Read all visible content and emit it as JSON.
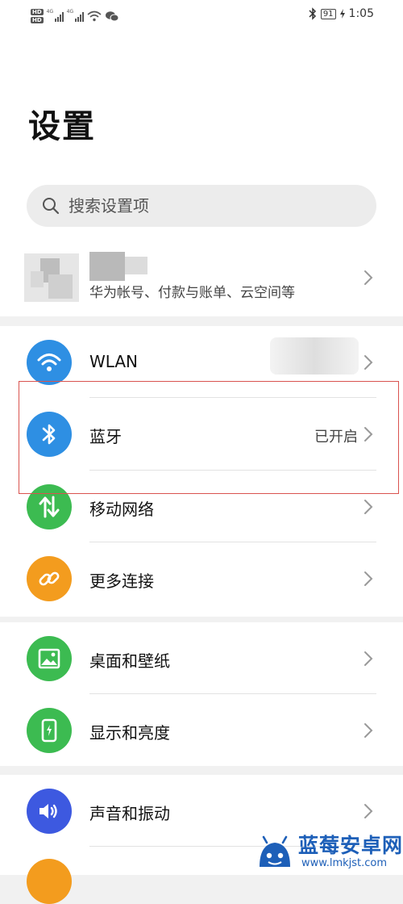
{
  "status_bar": {
    "hd_1": "HD",
    "hd_2": "HD",
    "net_1": "4G",
    "net_2": "4G",
    "battery": "91",
    "time": "1:05"
  },
  "page": {
    "title": "设置"
  },
  "search": {
    "placeholder": "搜索设置项"
  },
  "account": {
    "subtitle": "华为帐号、付款与账单、云空间等"
  },
  "groups": [
    {
      "items": [
        {
          "label": "WLAN",
          "icon": "wifi-icon",
          "color": "#2e8fe3"
        },
        {
          "label": "蓝牙",
          "status": "已开启",
          "icon": "bluetooth-icon",
          "color": "#2e8fe3"
        },
        {
          "label": "移动网络",
          "icon": "mobile-data-icon",
          "color": "#3cbb51"
        },
        {
          "label": "更多连接",
          "icon": "link-icon",
          "color": "#f39c1e"
        }
      ]
    },
    {
      "items": [
        {
          "label": "桌面和壁纸",
          "icon": "image-icon",
          "color": "#3cbb51"
        },
        {
          "label": "显示和亮度",
          "icon": "phone-brightness-icon",
          "color": "#3cbb51"
        }
      ]
    },
    {
      "items": [
        {
          "label": "声音和振动",
          "icon": "speaker-icon",
          "color": "#3d59e0"
        }
      ]
    }
  ],
  "watermark": {
    "name": "蓝莓安卓网",
    "url": "www.lmkjst.com"
  },
  "colors": {
    "highlight": "#d9534f",
    "accent_blue": "#2e8fe3",
    "green": "#3cbb51",
    "orange": "#f39c1e",
    "indigo": "#3d59e0"
  }
}
